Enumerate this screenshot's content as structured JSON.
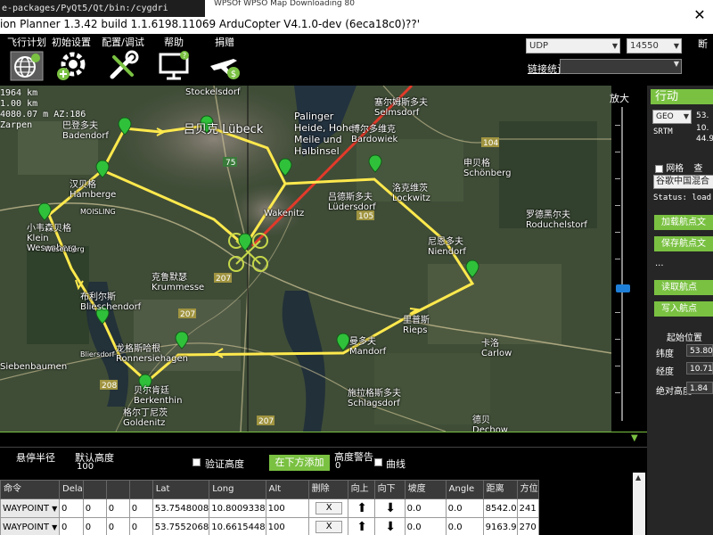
{
  "titlebar": {
    "path_text": "e-packages/PyQt5/Qt/bin:/cygdri",
    "behind_text": "WPSOf    WPSO     Map Downloading 80",
    "title": "ion Planner 1.3.42 build 1.1.6198.11069 ArduCopter V4.1.0-dev (6eca18c0)??'",
    "close": "✕"
  },
  "menu": {
    "items": [
      {
        "label": "飞行计划",
        "icon": "globe-icon"
      },
      {
        "label": "初始设置",
        "icon": "gear-plus-icon"
      },
      {
        "label": "配置/调试",
        "icon": "wrench-icon"
      },
      {
        "label": "帮助",
        "icon": "monitor-help-icon"
      },
      {
        "label": "捐赠",
        "icon": "plane-dollar-icon"
      }
    ],
    "right_label": "断",
    "connection_type": "UDP",
    "baud_rate": "14550",
    "link_stats_label": "链接统计"
  },
  "map": {
    "info_lines": [
      "1964 km",
      "1.00 km",
      "4080.07 m AZ:186",
      "Zarpen"
    ],
    "place_labels": [
      "Stockelsdorf",
      "吕贝克 Lübeck",
      "巴登多夫 Badendorf",
      "汉贝格 Hamberge",
      "MOISLING",
      "小韦森贝格 Klein Wesenberg",
      "Palinger Heide, Hohe Meile und Halbinsel",
      "塞尔姆斯多夫 Selmsdorf",
      "博尔多维克 Bardowiek",
      "申贝格 Schönberg",
      "Wakenitz",
      "吕德斯多夫 Lüdersdorf",
      "洛克维茨 Lockwitz",
      "尼恩多夫 Niendorf",
      "罗德黑尔夫 Roduchelstorf",
      "克鲁默瑟 Krummesse",
      "布利尔斯 Blieschendorf",
      "龙格斯哈根 Ronnersiehagen",
      "贝尔肯廷 Berkenthin",
      "格尔丁尼茨 Goldenitz",
      "里普斯 Rieps",
      "曼多夫 Mandorf",
      "卡洛 Carlow",
      "施拉格斯多夫 Schlagsdorf",
      "德贝 Dechow",
      "Siebenbaumen",
      "Bliersdorf",
      "Wesenberg"
    ],
    "road_numbers": [
      "75",
      "207",
      "207",
      "105",
      "104",
      "208"
    ]
  },
  "zoom": {
    "label": "放大"
  },
  "right_panel": {
    "tab": "行动",
    "geo_dropdown": "GEO",
    "geo_value": "53.",
    "srtm_label": "SRTM",
    "srtm_values": [
      "10.",
      "44.9"
    ],
    "grid_label": "网格",
    "query_label": "查",
    "map_source": "谷歌中国混合",
    "status": "Status: load",
    "buttons": [
      "加载航点文",
      "保存航点文",
      "读取航点",
      "写入航点"
    ],
    "dots": "...",
    "home": {
      "title": "起始位置",
      "lat_label": "纬度",
      "lat_value": "53.80",
      "lng_label": "经度",
      "lng_value": "10.71",
      "alt_label": "绝对高度",
      "alt_value": "1.84"
    }
  },
  "bottom": {
    "hover_radius_label": "悬停半径",
    "default_alt_label": "默认高度",
    "default_alt_value": "100",
    "verify_height_label": "验证高度",
    "add_below_label": "在下方添加",
    "alt_warning_label": "高度警告",
    "alt_warning_value": "0",
    "curve_label": "曲线",
    "table": {
      "headers": [
        "命令",
        "Dela",
        "",
        "",
        "",
        "Lat",
        "Long",
        "Alt",
        "删除",
        "向上",
        "向下",
        "坡度",
        "Angle",
        "距离",
        "方位"
      ],
      "rows": [
        {
          "cmd": "WAYPOINT",
          "p1": "0",
          "p2": "0",
          "p3": "0",
          "p4": "0",
          "lat": "53.7548008",
          "lng": "10.8009338",
          "alt": "100",
          "del": "X",
          "grad": "0.0",
          "angle": "0.0",
          "dist": "8542.0",
          "az": "241"
        },
        {
          "cmd": "WAYPOINT",
          "p1": "0",
          "p2": "0",
          "p3": "0",
          "p4": "0",
          "lat": "53.7552068",
          "lng": "10.6615448",
          "alt": "100",
          "del": "X",
          "grad": "0.0",
          "angle": "0.0",
          "dist": "9163.9",
          "az": "270"
        }
      ]
    }
  },
  "colors": {
    "accent": "#7ac142",
    "route": "#ffe94d",
    "marker": "#2fc13a"
  }
}
